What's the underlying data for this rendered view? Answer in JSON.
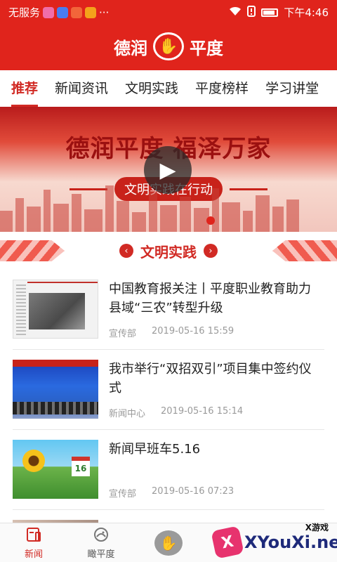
{
  "status_bar": {
    "carrier": "无服务",
    "time": "下午4:46",
    "more": "···"
  },
  "header": {
    "title_left": "德润",
    "title_right": "平度"
  },
  "tabs": [
    {
      "label": "推荐",
      "active": true
    },
    {
      "label": "新闻资讯",
      "active": false
    },
    {
      "label": "文明实践",
      "active": false
    },
    {
      "label": "平度榜样",
      "active": false
    },
    {
      "label": "学习讲堂",
      "active": false
    }
  ],
  "banner": {
    "headline": "德润平度 福泽万家",
    "subline": "文明实践在行动",
    "play_glyph": "▶"
  },
  "section": {
    "title": "文明实践",
    "prev_glyph": "‹",
    "next_glyph": "›"
  },
  "news": [
    {
      "title": "中国教育报关注丨平度职业教育助力县域“三农”转型升级",
      "source": "宣传部",
      "time": "2019-05-16 15:59"
    },
    {
      "title": "我市举行“双招双引”项目集中签约仪式",
      "source": "新闻中心",
      "time": "2019-05-16 15:14"
    },
    {
      "title": "新闻早班车5.16",
      "source": "宣传部",
      "time": "2019-05-16 07:23",
      "thumb_text": "16"
    },
    {
      "title": "",
      "source": "",
      "time": ""
    }
  ],
  "bottom_nav": [
    {
      "label": "新闻",
      "icon": "news-icon",
      "active": true
    },
    {
      "label": "瞰平度",
      "icon": "explore-icon",
      "active": false
    },
    {
      "label": "",
      "icon": "hand-logo-icon",
      "active": false
    }
  ],
  "watermark": {
    "text": "XYouXi.net",
    "small": "X游戏",
    "badge": "X"
  },
  "colors": {
    "brand_red": "#e0241c",
    "accent_red": "#d12a24",
    "meta_gray": "#9a9a9a"
  }
}
